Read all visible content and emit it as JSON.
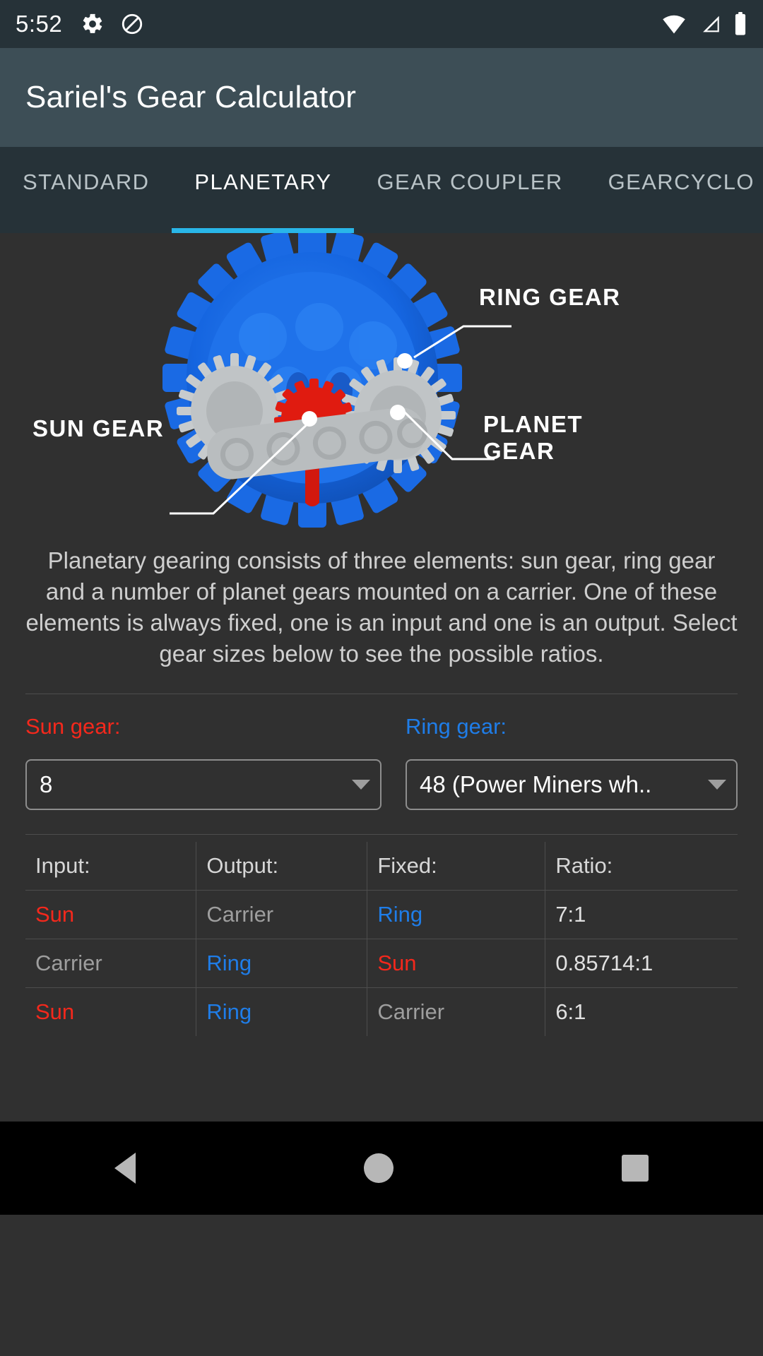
{
  "status_bar": {
    "time": "5:52",
    "left_icons": [
      "gear-icon",
      "do-not-disturb-icon"
    ],
    "right_icons": [
      "wifi-icon",
      "signal-icon",
      "battery-icon"
    ],
    "background": "#263238"
  },
  "app_bar": {
    "title": "Sariel's Gear Calculator",
    "background": "#3d4e56"
  },
  "tabs": {
    "items": [
      {
        "label": "STANDARD",
        "active": false
      },
      {
        "label": "PLANETARY",
        "active": true
      },
      {
        "label": "GEAR COUPLER",
        "active": false
      },
      {
        "label": "GEARCYCLO",
        "active": false
      }
    ],
    "indicator_color": "#29b6e8",
    "background": "#263238"
  },
  "illustration": {
    "callouts": {
      "sun": "SUN GEAR",
      "ring": "RING GEAR",
      "planet_line1": "PLANET",
      "planet_line2": "GEAR"
    },
    "colors": {
      "ring_gear": "#1565e0",
      "sun_gear": "#e01b10",
      "planet_gear": "#c0c4c6",
      "carrier": "#b9bdbf"
    }
  },
  "description": "Planetary gearing consists of three elements: sun gear, ring gear and a number of planet gears mounted on a carrier. One of these elements is always fixed, one is an input and one is an output. Select gear sizes below to see the possible ratios.",
  "selectors": {
    "sun": {
      "label": "Sun gear:",
      "value": "8",
      "color": "#f4281c"
    },
    "ring": {
      "label": "Ring gear:",
      "value": "48 (Power Miners wh..",
      "color": "#1f7de8"
    }
  },
  "results_table": {
    "headers": [
      "Input:",
      "Output:",
      "Fixed:",
      "Ratio:"
    ],
    "rows": [
      {
        "input": "Sun",
        "input_kind": "sun",
        "output": "Carrier",
        "output_kind": "carrier",
        "fixed": "Ring",
        "fixed_kind": "ring",
        "ratio": "7:1"
      },
      {
        "input": "Carrier",
        "input_kind": "carrier",
        "output": "Ring",
        "output_kind": "ring",
        "fixed": "Sun",
        "fixed_kind": "sun",
        "ratio": "0.85714:1"
      },
      {
        "input": "Sun",
        "input_kind": "sun",
        "output": "Ring",
        "output_kind": "ring",
        "fixed": "Carrier",
        "fixed_kind": "carrier",
        "ratio": "6:1"
      }
    ]
  },
  "nav_bar": {
    "items": [
      "back-icon",
      "home-icon",
      "recents-icon"
    ],
    "background": "#000000"
  }
}
